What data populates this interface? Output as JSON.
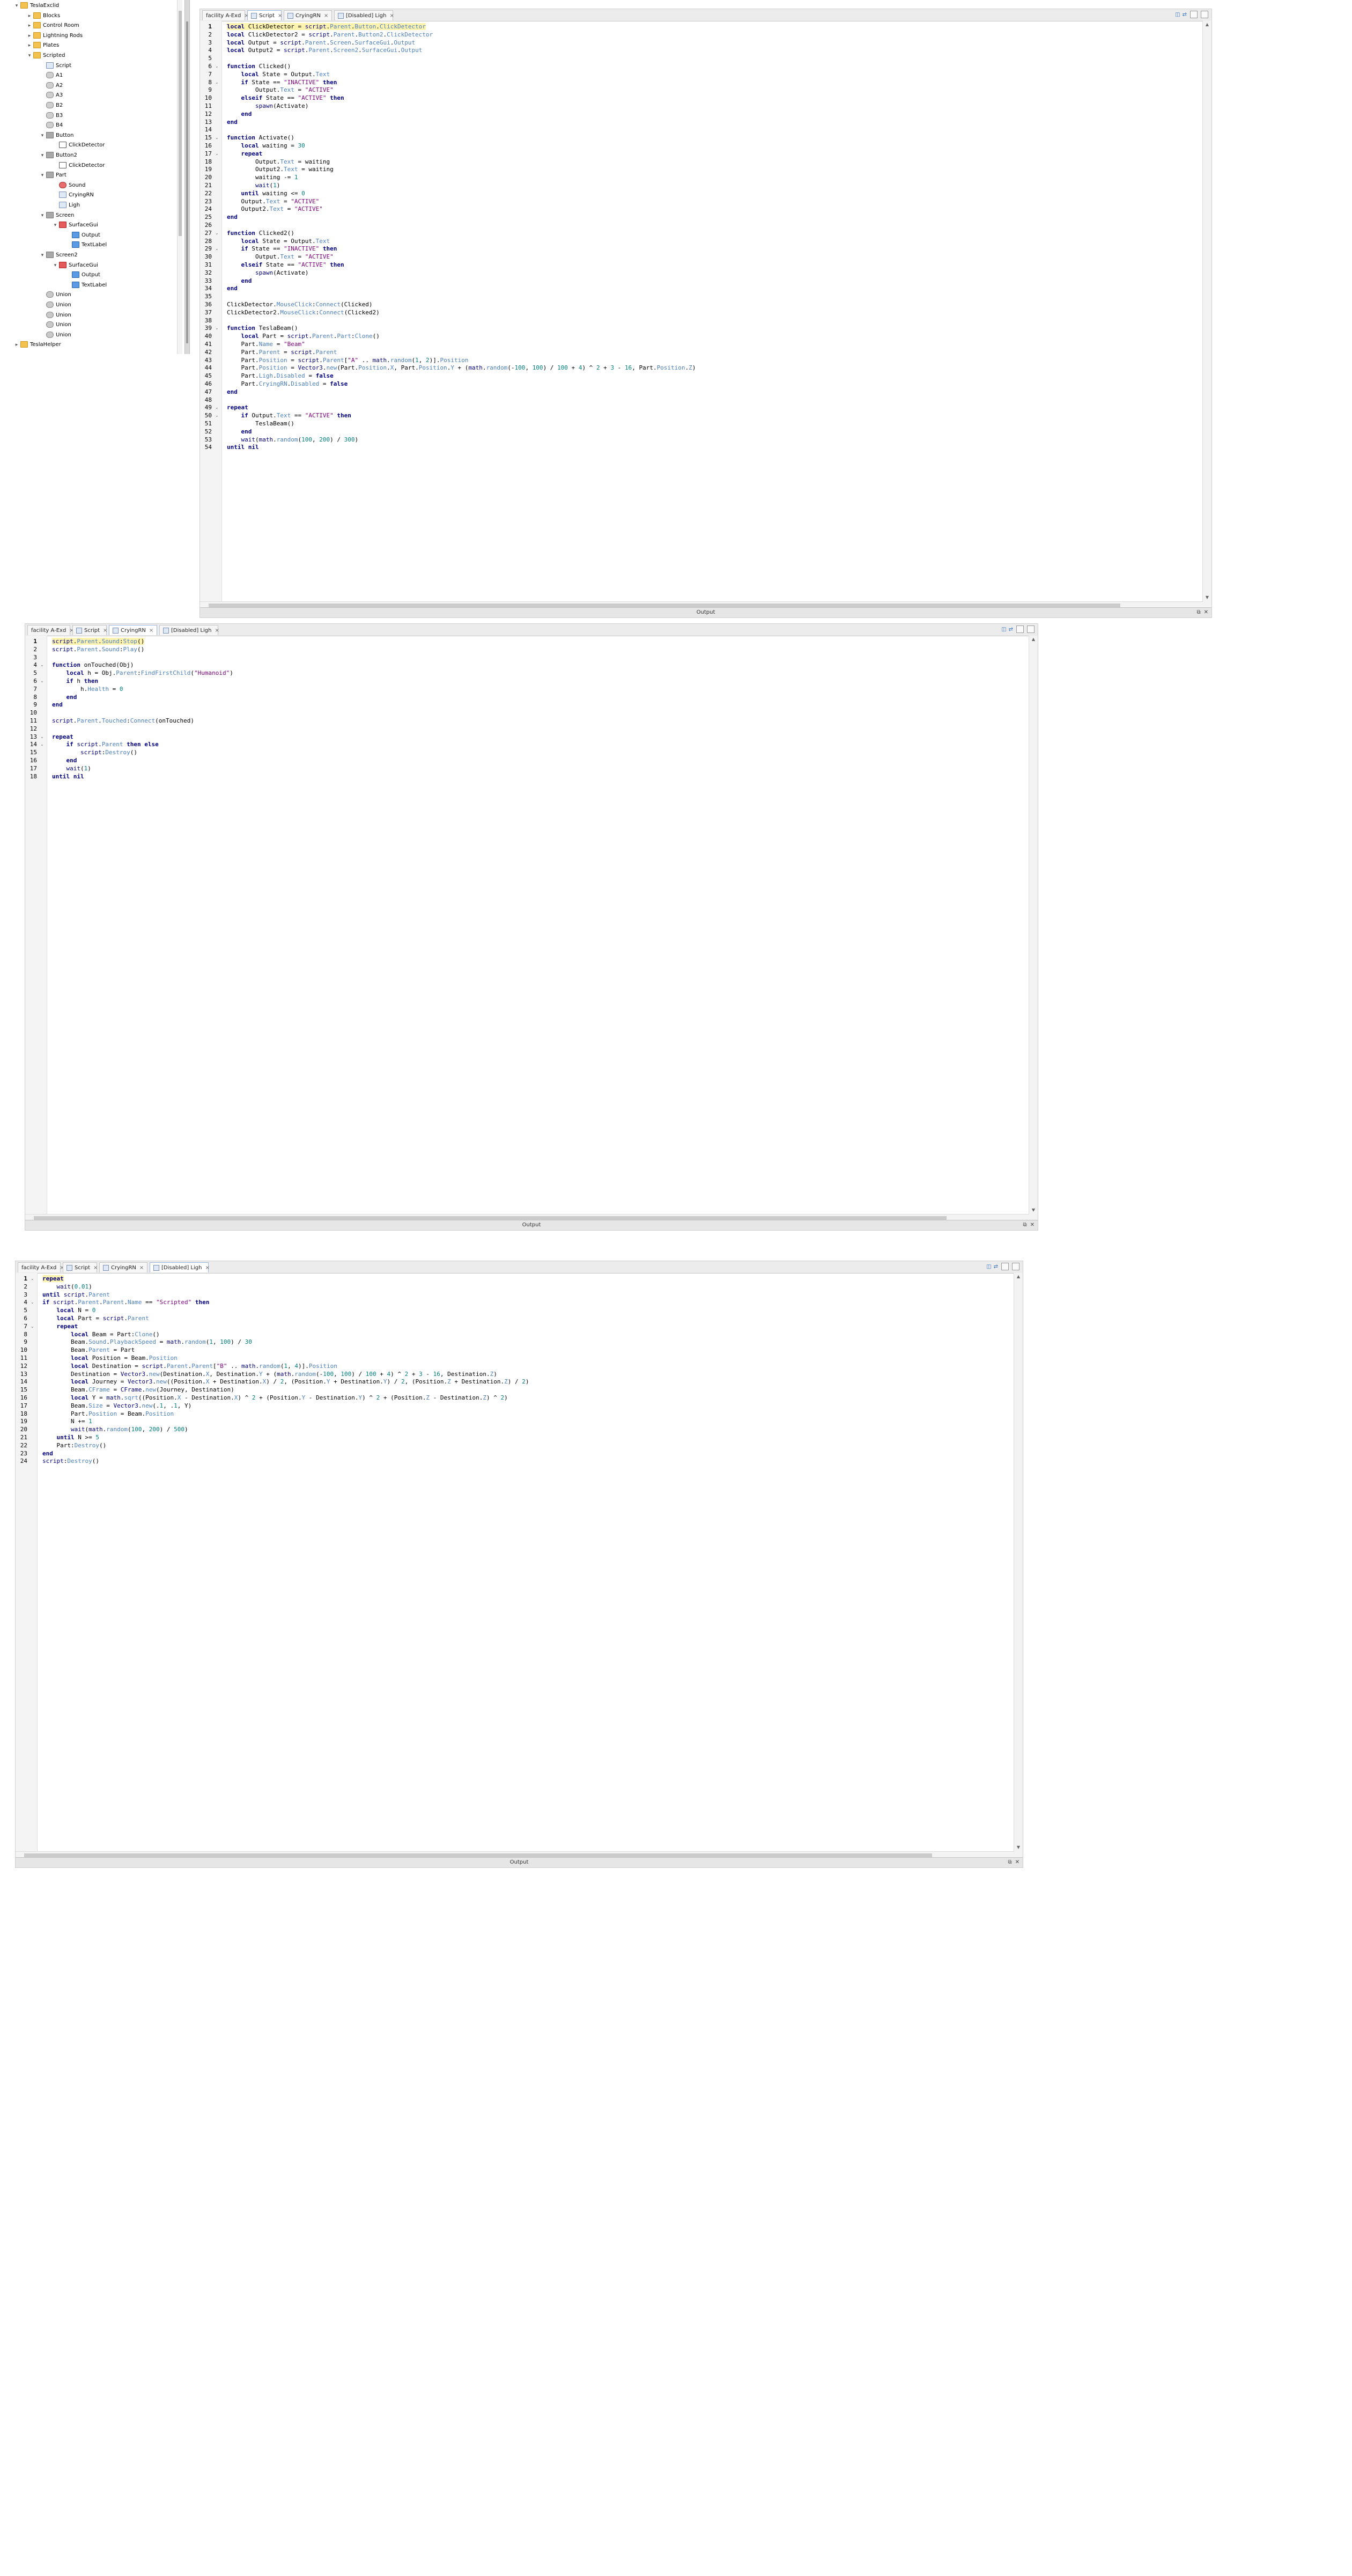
{
  "explorer": {
    "items": [
      {
        "label": "TeslaExclid",
        "depth": 0,
        "icon": "folder",
        "exp": "−"
      },
      {
        "label": "Blocks",
        "depth": 1,
        "icon": "folder",
        "exp": "+"
      },
      {
        "label": "Control Room",
        "depth": 1,
        "icon": "folder",
        "exp": "+"
      },
      {
        "label": "Lightning Rods",
        "depth": 1,
        "icon": "folder",
        "exp": "+"
      },
      {
        "label": "Plates",
        "depth": 1,
        "icon": "folder",
        "exp": "+"
      },
      {
        "label": "Scripted",
        "depth": 1,
        "icon": "folder",
        "exp": "−"
      },
      {
        "label": "Script",
        "depth": 2,
        "icon": "script",
        "exp": ""
      },
      {
        "label": "A1",
        "depth": 2,
        "icon": "model",
        "exp": ""
      },
      {
        "label": "A2",
        "depth": 2,
        "icon": "model",
        "exp": ""
      },
      {
        "label": "A3",
        "depth": 2,
        "icon": "model",
        "exp": ""
      },
      {
        "label": "B2",
        "depth": 2,
        "icon": "model",
        "exp": ""
      },
      {
        "label": "B3",
        "depth": 2,
        "icon": "model",
        "exp": ""
      },
      {
        "label": "B4",
        "depth": 2,
        "icon": "model",
        "exp": ""
      },
      {
        "label": "Button",
        "depth": 2,
        "icon": "part",
        "exp": "−"
      },
      {
        "label": "ClickDetector",
        "depth": 3,
        "icon": "click",
        "exp": ""
      },
      {
        "label": "Button2",
        "depth": 2,
        "icon": "part",
        "exp": "−"
      },
      {
        "label": "ClickDetector",
        "depth": 3,
        "icon": "click",
        "exp": ""
      },
      {
        "label": "Part",
        "depth": 2,
        "icon": "part",
        "exp": "−"
      },
      {
        "label": "Sound",
        "depth": 3,
        "icon": "sound",
        "exp": ""
      },
      {
        "label": "CryingRN",
        "depth": 3,
        "icon": "script",
        "exp": ""
      },
      {
        "label": "Ligh",
        "depth": 3,
        "icon": "script",
        "exp": ""
      },
      {
        "label": "Screen",
        "depth": 2,
        "icon": "part",
        "exp": "−"
      },
      {
        "label": "SurfaceGui",
        "depth": 3,
        "icon": "gui",
        "exp": "−"
      },
      {
        "label": "Output",
        "depth": 4,
        "icon": "label",
        "exp": ""
      },
      {
        "label": "TextLabel",
        "depth": 4,
        "icon": "label",
        "exp": ""
      },
      {
        "label": "Screen2",
        "depth": 2,
        "icon": "part",
        "exp": "−"
      },
      {
        "label": "SurfaceGui",
        "depth": 3,
        "icon": "gui",
        "exp": "−"
      },
      {
        "label": "Output",
        "depth": 4,
        "icon": "label",
        "exp": ""
      },
      {
        "label": "TextLabel",
        "depth": 4,
        "icon": "label",
        "exp": ""
      },
      {
        "label": "Union",
        "depth": 2,
        "icon": "union",
        "exp": ""
      },
      {
        "label": "Union",
        "depth": 2,
        "icon": "union",
        "exp": ""
      },
      {
        "label": "Union",
        "depth": 2,
        "icon": "union",
        "exp": ""
      },
      {
        "label": "Union",
        "depth": 2,
        "icon": "union",
        "exp": ""
      },
      {
        "label": "Union",
        "depth": 2,
        "icon": "union",
        "exp": ""
      },
      {
        "label": "TeslaHelper",
        "depth": 0,
        "icon": "folder",
        "exp": "+"
      }
    ]
  },
  "colors": {
    "keyword": "#00007f",
    "builtin": "#00007f",
    "string": "#7f007f",
    "number": "#007f7f",
    "property": "#00007f",
    "plain": "#000000",
    "field": "#4a7fbf"
  },
  "editors": [
    {
      "id": "editor-1",
      "tabs": [
        {
          "label": "facility A-Exd",
          "active": false
        },
        {
          "label": "Script",
          "active": true
        },
        {
          "label": "CryingRN",
          "active": false
        },
        {
          "label": "[Disabled] Ligh",
          "active": false
        }
      ],
      "output_label": "Output",
      "lines": [
        "local ClickDetector = script.Parent.Button.ClickDetector",
        "local ClickDetector2 = script.Parent.Button2.ClickDetector",
        "local Output = script.Parent.Screen.SurfaceGui.Output",
        "local Output2 = script.Parent.Screen2.SurfaceGui.Output",
        "",
        "function Clicked()",
        "    local State = Output.Text",
        "    if State == \"INACTIVE\" then",
        "        Output.Text = \"ACTIVE\"",
        "    elseif State == \"ACTIVE\" then",
        "        spawn(Activate)",
        "    end",
        "end",
        "",
        "function Activate()",
        "    local waiting = 30",
        "    repeat",
        "        Output.Text = waiting",
        "        Output2.Text = waiting",
        "        waiting -= 1",
        "        wait(1)",
        "    until waiting <= 0",
        "    Output.Text = \"ACTIVE\"",
        "    Output2.Text = \"ACTIVE\"",
        "end",
        "",
        "function Clicked2()",
        "    local State = Output.Text",
        "    if State == \"INACTIVE\" then",
        "        Output.Text = \"ACTIVE\"",
        "    elseif State == \"ACTIVE\" then",
        "        spawn(Activate)",
        "    end",
        "end",
        "",
        "ClickDetector.MouseClick:Connect(Clicked)",
        "ClickDetector2.MouseClick:Connect(Clicked2)",
        "",
        "function TeslaBeam()",
        "    local Part = script.Parent.Part:Clone()",
        "    Part.Name = \"Beam\"",
        "    Part.Parent = script.Parent",
        "    Part.Position = script.Parent[\"A\" .. math.random(1, 2)].Position",
        "    Part.Position = Vector3.new(Part.Position.X, Part.Position.Y + (math.random(-100, 100) / 100 + 4) ^ 2 + 3 - 16, Part.Position.Z)",
        "    Part.Ligh.Disabled = false",
        "    Part.CryingRN.Disabled = false",
        "end",
        "",
        "repeat",
        "    if Output.Text == \"ACTIVE\" then",
        "        TeslaBeam()",
        "    end",
        "    wait(math.random(100, 200) / 300)",
        "until nil"
      ],
      "folds": [
        6,
        8,
        15,
        17,
        27,
        29,
        39,
        49,
        50
      ]
    },
    {
      "id": "editor-2",
      "tabs": [
        {
          "label": "facility A-Exd",
          "active": false
        },
        {
          "label": "Script",
          "active": false
        },
        {
          "label": "CryingRN",
          "active": true
        },
        {
          "label": "[Disabled] Ligh",
          "active": false
        }
      ],
      "output_label": "Output",
      "lines": [
        "script.Parent.Sound:Stop()",
        "script.Parent.Sound:Play()",
        "",
        "function onTouched(Obj)",
        "    local h = Obj.Parent:FindFirstChild(\"Humanoid\")",
        "    if h then",
        "        h.Health = 0",
        "    end",
        "end",
        "",
        "script.Parent.Touched:Connect(onTouched)",
        "",
        "repeat",
        "    if script.Parent then else",
        "        script:Destroy()",
        "    end",
        "    wait(1)",
        "until nil"
      ],
      "folds": [
        4,
        6,
        13,
        14
      ]
    },
    {
      "id": "editor-3",
      "tabs": [
        {
          "label": "facility A-Exd",
          "active": false
        },
        {
          "label": "Script",
          "active": false
        },
        {
          "label": "CryingRN",
          "active": false
        },
        {
          "label": "[Disabled] Ligh",
          "active": true
        }
      ],
      "output_label": "Output",
      "lines": [
        "repeat",
        "    wait(0.01)",
        "until script.Parent",
        "if script.Parent.Parent.Name == \"Scripted\" then",
        "    local N = 0",
        "    local Part = script.Parent",
        "    repeat",
        "        local Beam = Part:Clone()",
        "        Beam.Sound.PlaybackSpeed = math.random(1, 100) / 30",
        "        Beam.Parent = Part",
        "        local Position = Beam.Position",
        "        local Destination = script.Parent.Parent[\"B\" .. math.random(1, 4)].Position",
        "        Destination = Vector3.new(Destination.X, Destination.Y + (math.random(-100, 100) / 100 + 4) ^ 2 + 3 - 16, Destination.Z)",
        "        local Journey = Vector3.new((Position.X + Destination.X) / 2, (Position.Y + Destination.Y) / 2, (Position.Z + Destination.Z) / 2)",
        "        Beam.CFrame = CFrame.new(Journey, Destination)",
        "        local Y = math.sqrt((Position.X - Destination.X) ^ 2 + (Position.Y - Destination.Y) ^ 2 + (Position.Z - Destination.Z) ^ 2)",
        "        Beam.Size = Vector3.new(.1, .1, Y)",
        "        Part.Position = Beam.Position",
        "        N += 1",
        "        wait(math.random(100, 200) / 500)",
        "    until N >= 5",
        "    Part:Destroy()",
        "end",
        "script:Destroy()"
      ],
      "folds": [
        1,
        4,
        7
      ]
    }
  ]
}
